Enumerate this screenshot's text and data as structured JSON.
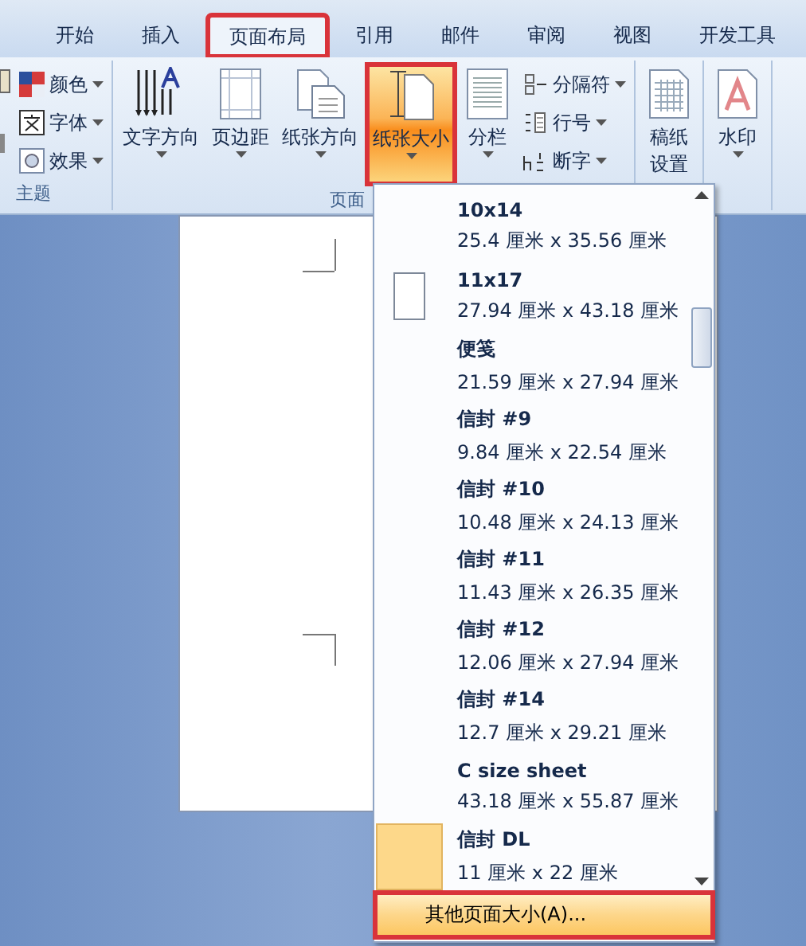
{
  "tabs": [
    {
      "label": "开始",
      "selected": false
    },
    {
      "label": "插入",
      "selected": false
    },
    {
      "label": "页面布局",
      "selected": true,
      "highlighted": true
    },
    {
      "label": "引用",
      "selected": false
    },
    {
      "label": "邮件",
      "selected": false
    },
    {
      "label": "审阅",
      "selected": false
    },
    {
      "label": "视图",
      "selected": false
    },
    {
      "label": "开发工具",
      "selected": false
    }
  ],
  "ribbon": {
    "groups": [
      {
        "label": "主题",
        "controls": [
          {
            "kind": "small",
            "label": "颜色",
            "dropdown": true
          },
          {
            "kind": "small",
            "label": "字体",
            "dropdown": true
          },
          {
            "kind": "small",
            "label": "效果",
            "dropdown": true
          }
        ]
      },
      {
        "label": "页面",
        "controls": [
          {
            "kind": "large",
            "label": "文字方向",
            "dropdown": true,
            "selected": false
          },
          {
            "kind": "large",
            "label": "页边距",
            "dropdown": true,
            "selected": false
          },
          {
            "kind": "large",
            "label": "纸张方向",
            "dropdown": true,
            "selected": false
          },
          {
            "kind": "large",
            "label": "纸张大小",
            "dropdown": true,
            "selected": true,
            "highlighted": true
          },
          {
            "kind": "large",
            "label": "分栏",
            "dropdown": true,
            "selected": false
          },
          {
            "kind": "small",
            "label": "分隔符",
            "dropdown": true
          },
          {
            "kind": "small",
            "label": "行号",
            "dropdown": true
          },
          {
            "kind": "small",
            "label": "断字",
            "dropdown": true
          }
        ]
      },
      {
        "controls": [
          {
            "kind": "large",
            "label": "稿纸设置",
            "dropdown": false,
            "selected": false
          }
        ]
      },
      {
        "controls": [
          {
            "kind": "large",
            "label": "水印",
            "dropdown": true,
            "selected": false
          }
        ]
      }
    ]
  },
  "size_menu": {
    "items": [
      {
        "name": "10x14",
        "size": "25.4 厘米 x 35.56 厘米",
        "kind": "plain",
        "selected": false
      },
      {
        "name": "11x17",
        "size": "27.94 厘米 x 43.18 厘米",
        "kind": "page",
        "selected": false
      },
      {
        "name": "便笺",
        "size": "21.59 厘米 x 27.94 厘米",
        "kind": "plain",
        "selected": false
      },
      {
        "name": "信封 #9",
        "size": "9.84 厘米 x 22.54 厘米",
        "kind": "plain",
        "selected": false
      },
      {
        "name": "信封 #10",
        "size": "10.48 厘米 x 24.13 厘米",
        "kind": "plain",
        "selected": false
      },
      {
        "name": "信封 #11",
        "size": "11.43 厘米 x 26.35 厘米",
        "kind": "plain",
        "selected": false
      },
      {
        "name": "信封 #12",
        "size": "12.06 厘米 x 27.94 厘米",
        "kind": "plain",
        "selected": false
      },
      {
        "name": "信封 #14",
        "size": "12.7 厘米 x 29.21 厘米",
        "kind": "plain",
        "selected": false
      },
      {
        "name": "C size sheet",
        "size": "43.18 厘米 x 55.87 厘米",
        "kind": "plain",
        "selected": false
      },
      {
        "name": "信封 DL",
        "size": "11 厘米 x 22 厘米",
        "kind": "plain",
        "selected": true
      }
    ],
    "footer": {
      "label": "其他页面大小(A)...",
      "highlighted": true
    }
  }
}
